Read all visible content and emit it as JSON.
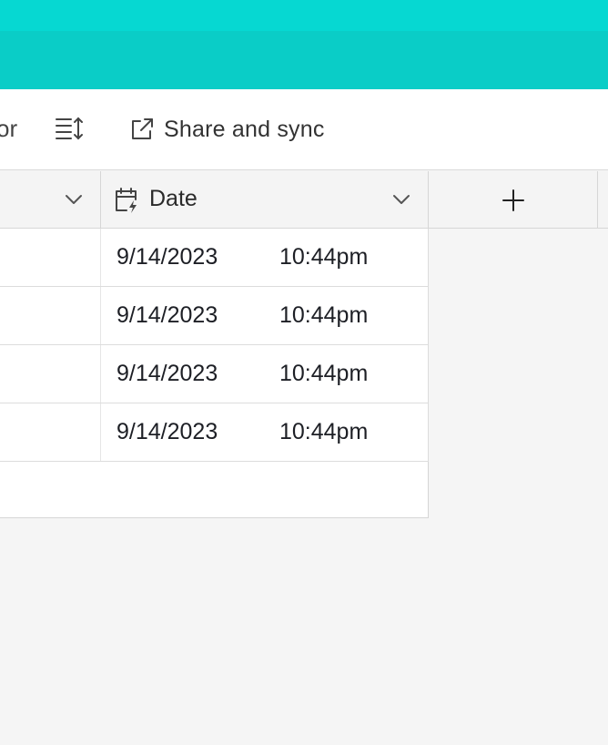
{
  "toolbar": {
    "truncated_label": "or",
    "share_label": "Share and sync",
    "icons": {
      "row_height": "row-height-icon",
      "share": "share-icon"
    }
  },
  "grid": {
    "header": {
      "date_field_label": "Date",
      "date_field_icon": "calendar-lightning-icon",
      "add_field_icon": "plus-icon"
    },
    "rows": [
      {
        "date": "9/14/2023",
        "time": "10:44pm"
      },
      {
        "date": "9/14/2023",
        "time": "10:44pm"
      },
      {
        "date": "9/14/2023",
        "time": "10:44pm"
      },
      {
        "date": "9/14/2023",
        "time": "10:44pm"
      }
    ]
  },
  "colors": {
    "header_teal_top": "#06d8d2",
    "header_teal_bottom": "#0acdc7",
    "page_bg": "#f5f5f5"
  }
}
